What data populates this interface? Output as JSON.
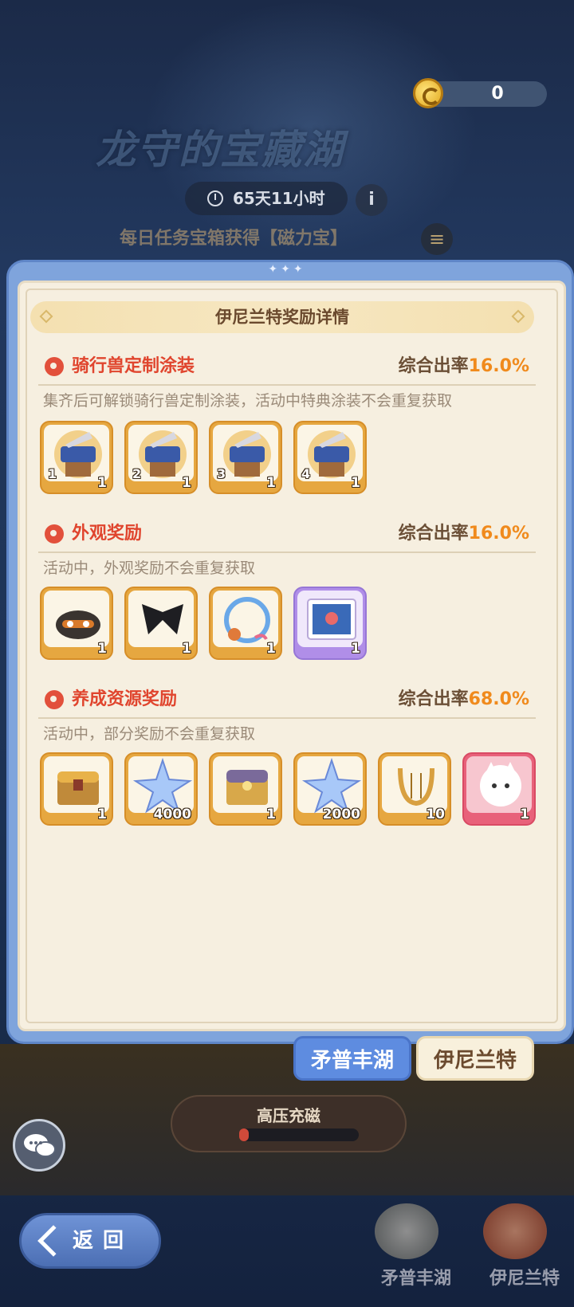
{
  "currency": {
    "value": "0",
    "icon": "coin-icon"
  },
  "event": {
    "title": "龙守的宝藏湖",
    "timer": "65天11小时",
    "daily_hint": "每日任务宝箱获得【磁力宝】"
  },
  "panel": {
    "header": "伊尼兰特奖励详情",
    "sections": [
      {
        "name": "骑行兽定制涂装",
        "rate_label": "综合出率",
        "rate_value": "16.0%",
        "desc": "集齐后可解锁骑行兽定制涂装，活动中特典涂装不会重复获取",
        "items": [
          {
            "icon": "mount-skin-icon",
            "index": "1",
            "qty": "1",
            "rarity": "orange"
          },
          {
            "icon": "mount-skin-icon",
            "index": "2",
            "qty": "1",
            "rarity": "orange"
          },
          {
            "icon": "mount-skin-icon",
            "index": "3",
            "qty": "1",
            "rarity": "orange"
          },
          {
            "icon": "mount-skin-icon",
            "index": "4",
            "qty": "1",
            "rarity": "orange"
          }
        ]
      },
      {
        "name": "外观奖励",
        "rate_label": "综合出率",
        "rate_value": "16.0%",
        "desc": "活动中，外观奖励不会重复获取",
        "items": [
          {
            "icon": "helmet-icon",
            "qty": "1",
            "rarity": "orange"
          },
          {
            "icon": "wings-icon",
            "qty": "1",
            "rarity": "orange"
          },
          {
            "icon": "avatar-frame-icon",
            "qty": "1",
            "rarity": "orange"
          },
          {
            "icon": "photo-card-icon",
            "qty": "1",
            "rarity": "purple"
          }
        ]
      },
      {
        "name": "养成资源奖励",
        "rate_label": "综合出率",
        "rate_value": "68.0%",
        "desc": "活动中，部分奖励不会重复获取",
        "items": [
          {
            "icon": "treasure-chest-icon",
            "qty": "1",
            "rarity": "orange"
          },
          {
            "icon": "star-crystal-icon",
            "qty": "4000",
            "rarity": "orange"
          },
          {
            "icon": "gold-chest-icon",
            "qty": "1",
            "rarity": "orange"
          },
          {
            "icon": "star-crystal-icon",
            "qty": "2000",
            "rarity": "orange"
          },
          {
            "icon": "lyre-icon",
            "qty": "10",
            "rarity": "orange"
          },
          {
            "icon": "cat-avatar-icon",
            "qty": "1",
            "rarity": "pink"
          }
        ]
      }
    ]
  },
  "tabs": [
    {
      "label": "矛普丰湖",
      "active": false
    },
    {
      "label": "伊尼兰特",
      "active": true
    }
  ],
  "charge": {
    "label": "高压充磁",
    "progress": 0.08
  },
  "back_button": {
    "label": "返回"
  },
  "bottom_nav": [
    {
      "label": "矛普丰湖"
    },
    {
      "label": "伊尼兰特"
    }
  ],
  "colors": {
    "accent_red": "#e0452e",
    "rate_orange": "#f08a1c",
    "panel_blue": "#7fa4dc",
    "paper": "#f6efe0"
  }
}
